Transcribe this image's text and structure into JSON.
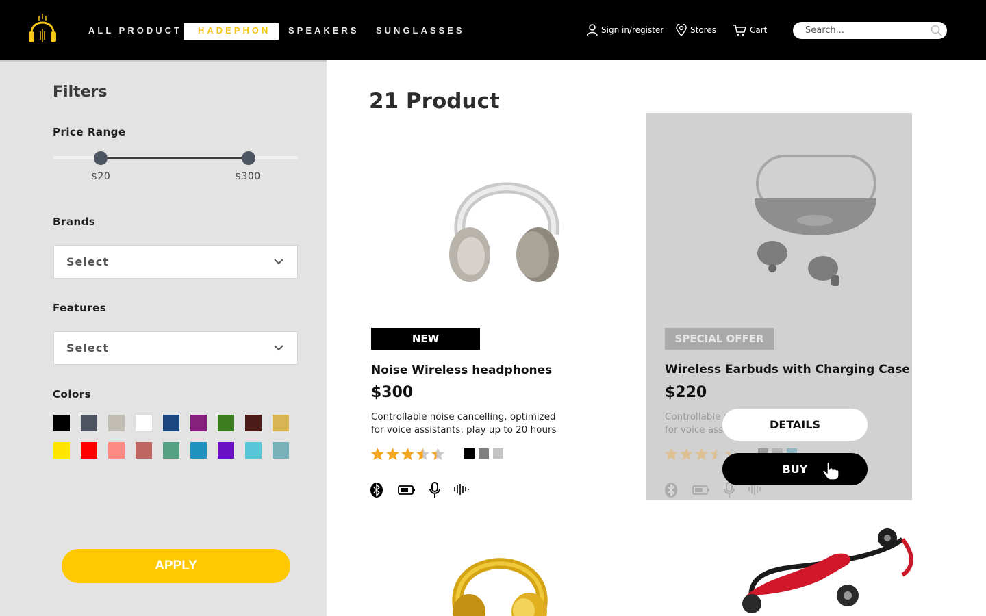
{
  "nav": {
    "items": [
      {
        "label": "ALL PRODUCT",
        "active": false
      },
      {
        "label": "HADEPHON",
        "active": true
      },
      {
        "label": "SPEAKERS",
        "active": false
      },
      {
        "label": "SUNGLASSES",
        "active": false
      }
    ],
    "accent_color": "#f5c518"
  },
  "header_utils": {
    "signin_label": "Sign in/register",
    "signin_icon": "user-icon",
    "stores_label": "Stores",
    "stores_icon": "location-pin-icon",
    "cart_label": "Cart",
    "cart_icon": "cart-icon"
  },
  "search": {
    "placeholder": "Search...",
    "value": "",
    "icon": "search-icon"
  },
  "filters": {
    "title": "Filters",
    "price_range": {
      "label": "Price Range",
      "min_label": "$20",
      "max_label": "$300",
      "min_value": 20,
      "max_value": 300
    },
    "brands": {
      "label": "Brands",
      "selected": "Select"
    },
    "features": {
      "label": "Features",
      "selected": "Select"
    },
    "colors": {
      "label": "Colors",
      "swatches": [
        "#000000",
        "#4e5560",
        "#c2bdb5",
        "#ffffff",
        "#1c4882",
        "#86207c",
        "#3b7c1e",
        "#4a1b17",
        "#d8b552",
        "#ffe600",
        "#ff0000",
        "#ff8a84",
        "#c06662",
        "#56a184",
        "#1f91bf",
        "#6a11c5",
        "#57c6d8",
        "#78b1b9"
      ]
    },
    "apply_label": "APPLY",
    "apply_color": "#ffc800"
  },
  "main": {
    "count_title": "21 Product"
  },
  "products": [
    {
      "badge": "NEW",
      "name": "Noise Wireless headphones",
      "price": "$300",
      "desc_line1": "Controllable noise cancelling, optimized",
      "desc_line2": "for voice assistants, play up to 20 hours",
      "rating": 3.5,
      "colors": [
        "#000000",
        "#808080",
        "#c4c4c4"
      ],
      "features": [
        "bluetooth-icon",
        "battery-icon",
        "microphone-icon",
        "sound-wave-icon"
      ]
    },
    {
      "badge": "SPECIAL OFFER",
      "name": "Wireless Earbuds with Charging Case",
      "price": "$220",
      "desc_line1": "Controllable noise cancelling, optimized",
      "desc_line2": "for voice assistants, play up to 20 hours",
      "rating": 3.5,
      "colors": [
        "#9a9a9a",
        "#b5b5b5",
        "#8fb6c2"
      ],
      "features": [
        "bluetooth-icon",
        "battery-icon",
        "microphone-icon",
        "sound-wave-icon"
      ],
      "details_label": "DETAILS",
      "buy_label": "BUY"
    }
  ]
}
